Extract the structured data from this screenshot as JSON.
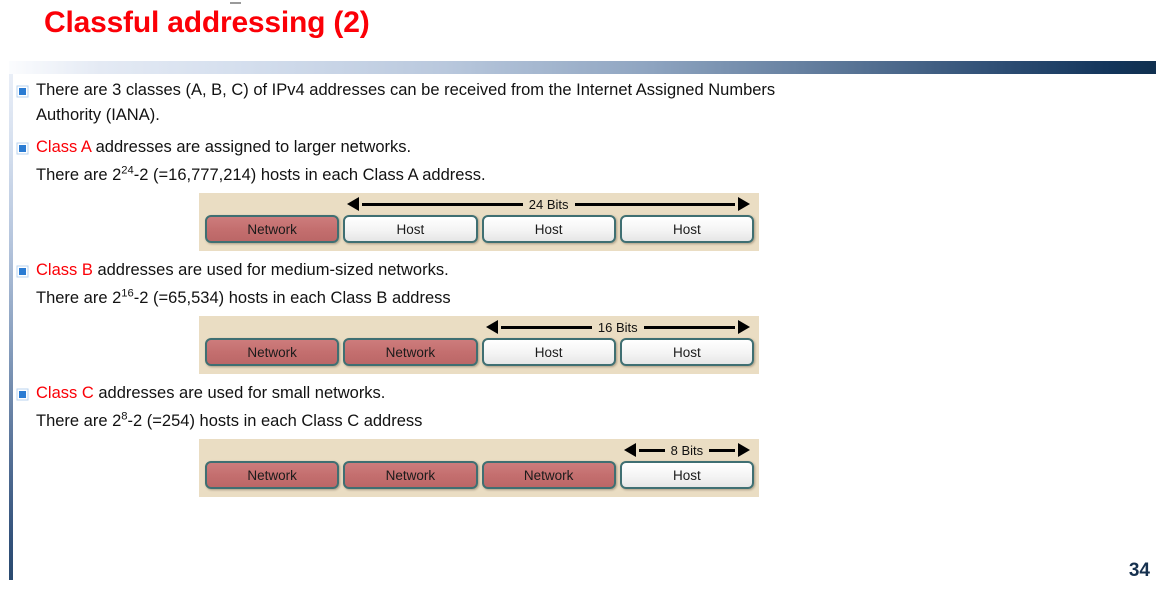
{
  "slide": {
    "title": "Classful addressing (2)",
    "page_number": "34",
    "title_color": "#fb0007",
    "accent_red": "#fb0007",
    "bullet_color": "#2b7cd3",
    "diagram_background": "#eaddc3",
    "network_block_color": "#c46f6f",
    "host_block_color": "#f4f4f4",
    "block_border_color": "#3f6f72",
    "header_gradient_from": "#fbfcfe",
    "header_gradient_to": "#10304f"
  },
  "body": {
    "intro": {
      "line1": "There are 3 classes (A, B, C) of IPv4 addresses can be received from the Internet Assigned Numbers",
      "line2": "Authority (IANA)."
    },
    "sections": [
      {
        "id": "class-a",
        "class_label": "Class A",
        "headline_rest": " addresses are assigned to larger networks.",
        "hosts_prefix": "There are 2",
        "hosts_exponent": "24",
        "hosts_suffix": "-2 (=16,777,214) hosts in each Class A address.",
        "diagram": {
          "bits_label": "24 Bits",
          "bits_span_start_index": 1,
          "bits_span_count": 3,
          "octets": [
            {
              "label": "Network",
              "kind": "net"
            },
            {
              "label": "Host",
              "kind": "host"
            },
            {
              "label": "Host",
              "kind": "host"
            },
            {
              "label": "Host",
              "kind": "host"
            }
          ]
        }
      },
      {
        "id": "class-b",
        "class_label": "Class B",
        "headline_rest": " addresses are used for medium-sized networks.",
        "hosts_prefix": "There are 2",
        "hosts_exponent": "16",
        "hosts_suffix": "-2 (=65,534) hosts in each Class B address",
        "diagram": {
          "bits_label": "16 Bits",
          "bits_span_start_index": 2,
          "bits_span_count": 2,
          "octets": [
            {
              "label": "Network",
              "kind": "net"
            },
            {
              "label": "Network",
              "kind": "net"
            },
            {
              "label": "Host",
              "kind": "host"
            },
            {
              "label": "Host",
              "kind": "host"
            }
          ]
        }
      },
      {
        "id": "class-c",
        "class_label": "Class C",
        "headline_rest": " addresses are used for small networks.",
        "hosts_prefix": "There are 2",
        "hosts_exponent": "8",
        "hosts_suffix": "-2 (=254) hosts in each Class C address",
        "diagram": {
          "bits_label": "8 Bits",
          "bits_span_start_index": 3,
          "bits_span_count": 1,
          "octets": [
            {
              "label": "Network",
              "kind": "net"
            },
            {
              "label": "Network",
              "kind": "net"
            },
            {
              "label": "Network",
              "kind": "net"
            },
            {
              "label": "Host",
              "kind": "host"
            }
          ]
        }
      }
    ]
  }
}
